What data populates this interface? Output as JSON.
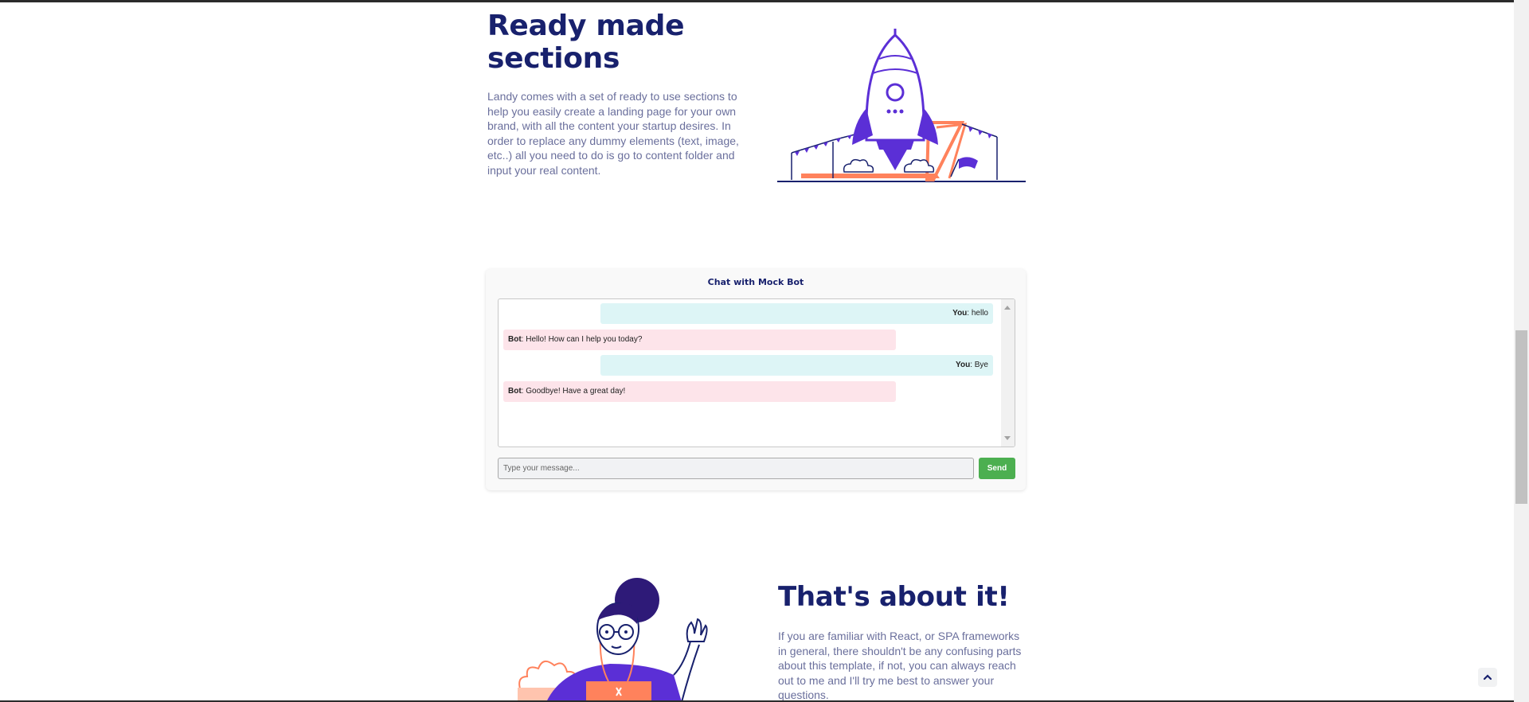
{
  "section_ready": {
    "title": "Ready made sections",
    "text": "Landy comes with a set of ready to use sections to help you easily create a landing page for your own brand, with all the content your startup desires. In order to replace any dummy elements (text, image, etc..) all you need to do is go to content folder and input your real content."
  },
  "chat": {
    "title": "Chat with Mock Bot",
    "messages": [
      {
        "sender": "You",
        "text": "hello",
        "role": "user"
      },
      {
        "sender": "Bot",
        "text": "Hello! How can I help you today?",
        "role": "bot"
      },
      {
        "sender": "You",
        "text": "Bye",
        "role": "user"
      },
      {
        "sender": "Bot",
        "text": "Goodbye! Have a great day!",
        "role": "bot"
      }
    ],
    "input_placeholder": "Type your message...",
    "input_value": "",
    "send_label": "Send"
  },
  "section_about": {
    "title": "That's about it!",
    "text": "If you are familiar with React, or SPA frameworks in general, there shouldn't be any confusing parts about this template, if not, you can always reach out to me and I'll try me best to answer your questions."
  },
  "colors": {
    "heading": "#18216d",
    "body_text": "#6a6f9c",
    "accent_purple": "#5b2fd6",
    "accent_orange": "#ff825c",
    "send_button": "#4caf50"
  },
  "icons": {
    "scroll_to_top": "chevron-up-icon"
  }
}
